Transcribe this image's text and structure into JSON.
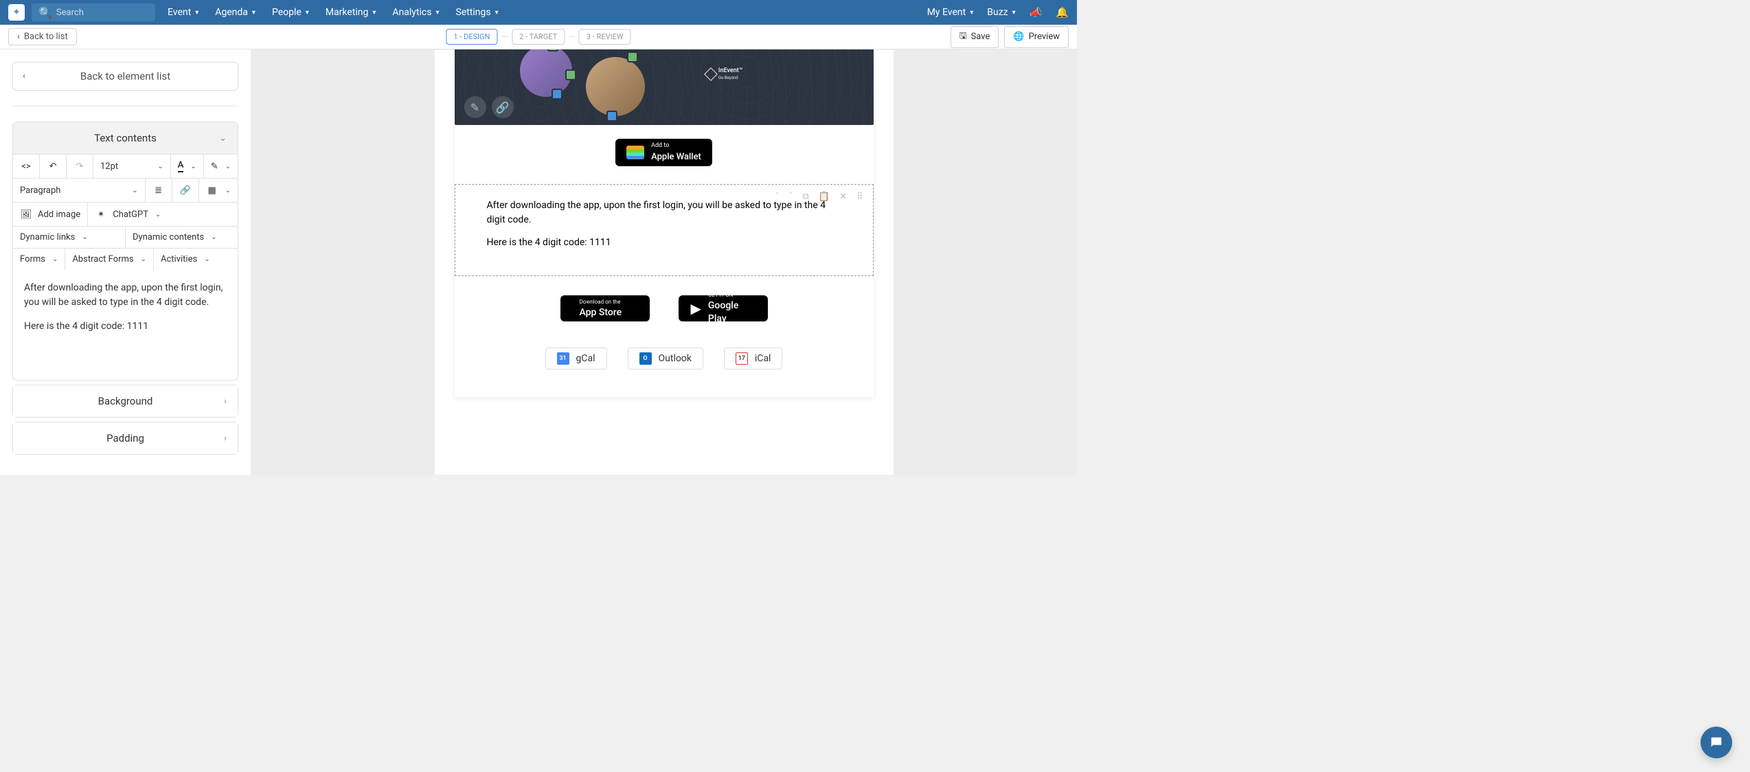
{
  "topnav": {
    "search_placeholder": "Search",
    "items": [
      "Event",
      "Agenda",
      "People",
      "Marketing",
      "Analytics",
      "Settings"
    ],
    "right": {
      "my_event": "My Event",
      "buzz": "Buzz"
    }
  },
  "secbar": {
    "back": "Back to list",
    "steps": [
      "1 - DESIGN",
      "2 - TARGET",
      "3 - REVIEW"
    ],
    "active_step": 0,
    "save": "Save",
    "preview": "Preview"
  },
  "sidebar": {
    "back_to_list": "Back to element list",
    "panel_text": "Text contents",
    "font_size": "12pt",
    "paragraph": "Paragraph",
    "add_image": "Add image",
    "chatgpt": "ChatGPT",
    "dynamic_links": "Dynamic links",
    "dynamic_contents": "Dynamic contents",
    "forms": "Forms",
    "abstract_forms": "Abstract Forms",
    "activities": "Activities",
    "editor_line1": "After downloading the app, upon the first login, you will be asked to type in the 4 digit code.",
    "editor_line2": "Here is the 4 digit code: 1111",
    "background": "Background",
    "padding": "Padding"
  },
  "email": {
    "logo_text": "InEvent",
    "logo_tag": "Go Beyond",
    "wallet_small": "Add to",
    "wallet_main": "Apple Wallet",
    "block_line1": "After downloading the app, upon the first login, you will be asked to type in the 4 digit code.",
    "block_line2": "Here is the 4 digit code: 1111",
    "appstore_small": "Download on the",
    "appstore_main": "App Store",
    "gplay_small": "GET IT ON",
    "gplay_main": "Google Play",
    "cal": {
      "gcal": "gCal",
      "outlook": "Outlook",
      "ical": "iCal",
      "gcal_day": "31",
      "ical_day": "17"
    }
  }
}
